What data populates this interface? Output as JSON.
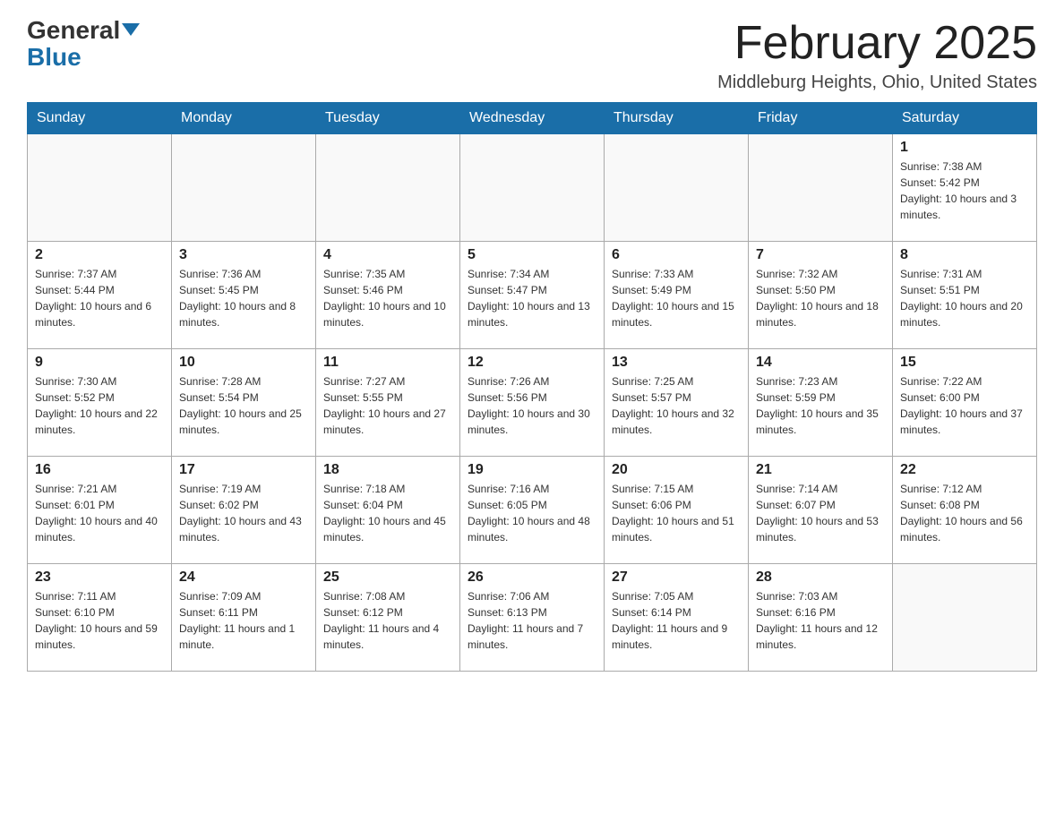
{
  "header": {
    "logo_general": "General",
    "logo_blue": "Blue",
    "title": "February 2025",
    "subtitle": "Middleburg Heights, Ohio, United States"
  },
  "weekdays": [
    "Sunday",
    "Monday",
    "Tuesday",
    "Wednesday",
    "Thursday",
    "Friday",
    "Saturday"
  ],
  "weeks": [
    [
      {
        "day": "",
        "info": ""
      },
      {
        "day": "",
        "info": ""
      },
      {
        "day": "",
        "info": ""
      },
      {
        "day": "",
        "info": ""
      },
      {
        "day": "",
        "info": ""
      },
      {
        "day": "",
        "info": ""
      },
      {
        "day": "1",
        "info": "Sunrise: 7:38 AM\nSunset: 5:42 PM\nDaylight: 10 hours and 3 minutes."
      }
    ],
    [
      {
        "day": "2",
        "info": "Sunrise: 7:37 AM\nSunset: 5:44 PM\nDaylight: 10 hours and 6 minutes."
      },
      {
        "day": "3",
        "info": "Sunrise: 7:36 AM\nSunset: 5:45 PM\nDaylight: 10 hours and 8 minutes."
      },
      {
        "day": "4",
        "info": "Sunrise: 7:35 AM\nSunset: 5:46 PM\nDaylight: 10 hours and 10 minutes."
      },
      {
        "day": "5",
        "info": "Sunrise: 7:34 AM\nSunset: 5:47 PM\nDaylight: 10 hours and 13 minutes."
      },
      {
        "day": "6",
        "info": "Sunrise: 7:33 AM\nSunset: 5:49 PM\nDaylight: 10 hours and 15 minutes."
      },
      {
        "day": "7",
        "info": "Sunrise: 7:32 AM\nSunset: 5:50 PM\nDaylight: 10 hours and 18 minutes."
      },
      {
        "day": "8",
        "info": "Sunrise: 7:31 AM\nSunset: 5:51 PM\nDaylight: 10 hours and 20 minutes."
      }
    ],
    [
      {
        "day": "9",
        "info": "Sunrise: 7:30 AM\nSunset: 5:52 PM\nDaylight: 10 hours and 22 minutes."
      },
      {
        "day": "10",
        "info": "Sunrise: 7:28 AM\nSunset: 5:54 PM\nDaylight: 10 hours and 25 minutes."
      },
      {
        "day": "11",
        "info": "Sunrise: 7:27 AM\nSunset: 5:55 PM\nDaylight: 10 hours and 27 minutes."
      },
      {
        "day": "12",
        "info": "Sunrise: 7:26 AM\nSunset: 5:56 PM\nDaylight: 10 hours and 30 minutes."
      },
      {
        "day": "13",
        "info": "Sunrise: 7:25 AM\nSunset: 5:57 PM\nDaylight: 10 hours and 32 minutes."
      },
      {
        "day": "14",
        "info": "Sunrise: 7:23 AM\nSunset: 5:59 PM\nDaylight: 10 hours and 35 minutes."
      },
      {
        "day": "15",
        "info": "Sunrise: 7:22 AM\nSunset: 6:00 PM\nDaylight: 10 hours and 37 minutes."
      }
    ],
    [
      {
        "day": "16",
        "info": "Sunrise: 7:21 AM\nSunset: 6:01 PM\nDaylight: 10 hours and 40 minutes."
      },
      {
        "day": "17",
        "info": "Sunrise: 7:19 AM\nSunset: 6:02 PM\nDaylight: 10 hours and 43 minutes."
      },
      {
        "day": "18",
        "info": "Sunrise: 7:18 AM\nSunset: 6:04 PM\nDaylight: 10 hours and 45 minutes."
      },
      {
        "day": "19",
        "info": "Sunrise: 7:16 AM\nSunset: 6:05 PM\nDaylight: 10 hours and 48 minutes."
      },
      {
        "day": "20",
        "info": "Sunrise: 7:15 AM\nSunset: 6:06 PM\nDaylight: 10 hours and 51 minutes."
      },
      {
        "day": "21",
        "info": "Sunrise: 7:14 AM\nSunset: 6:07 PM\nDaylight: 10 hours and 53 minutes."
      },
      {
        "day": "22",
        "info": "Sunrise: 7:12 AM\nSunset: 6:08 PM\nDaylight: 10 hours and 56 minutes."
      }
    ],
    [
      {
        "day": "23",
        "info": "Sunrise: 7:11 AM\nSunset: 6:10 PM\nDaylight: 10 hours and 59 minutes."
      },
      {
        "day": "24",
        "info": "Sunrise: 7:09 AM\nSunset: 6:11 PM\nDaylight: 11 hours and 1 minute."
      },
      {
        "day": "25",
        "info": "Sunrise: 7:08 AM\nSunset: 6:12 PM\nDaylight: 11 hours and 4 minutes."
      },
      {
        "day": "26",
        "info": "Sunrise: 7:06 AM\nSunset: 6:13 PM\nDaylight: 11 hours and 7 minutes."
      },
      {
        "day": "27",
        "info": "Sunrise: 7:05 AM\nSunset: 6:14 PM\nDaylight: 11 hours and 9 minutes."
      },
      {
        "day": "28",
        "info": "Sunrise: 7:03 AM\nSunset: 6:16 PM\nDaylight: 11 hours and 12 minutes."
      },
      {
        "day": "",
        "info": ""
      }
    ]
  ]
}
